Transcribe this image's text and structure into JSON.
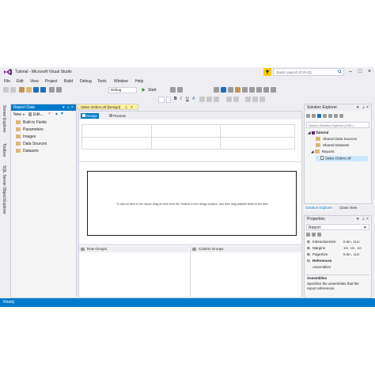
{
  "window": {
    "title": "Tutorial - Microsoft Visual Studio"
  },
  "quick_launch": {
    "placeholder": "Quick Launch (Ctrl+Q)"
  },
  "menu": [
    "File",
    "Edit",
    "View",
    "Project",
    "Build",
    "Debug",
    "Tools",
    "Window",
    "Help"
  ],
  "toolbar": {
    "config": "Debug",
    "start": "Start"
  },
  "side_tabs": [
    "Server Explorer",
    "Toolbox",
    "SQL Server Object Explorer"
  ],
  "report_data": {
    "title": "Report Data",
    "new_label": "New",
    "edit_label": "Edit...",
    "items": [
      "Built-in Fields",
      "Parameters",
      "Images",
      "Data Sources",
      "Datasets"
    ]
  },
  "document_tab": {
    "label": "Sales Orders.rdl [Design]"
  },
  "view_tabs": {
    "design": "Design",
    "preview": "Preview"
  },
  "design_surface": {
    "message": "To add an item to the report: drag an item from the Toolbox to the design surface, and then drag dataset fields to the item."
  },
  "groups": {
    "row": "Row Groups",
    "column": "Column Groups"
  },
  "solution_explorer": {
    "title": "Solution Explorer",
    "search_placeholder": "Search Solution Explorer (Ctrl+;)",
    "items": [
      {
        "label": "Tutorial"
      },
      {
        "label": "Shared Data Sources"
      },
      {
        "label": "Shared Datasets"
      },
      {
        "label": "Reports"
      },
      {
        "label": "Sales Orders.rdl"
      }
    ],
    "tabs": [
      "Solution Explorer",
      "Class View"
    ]
  },
  "properties": {
    "title": "Properties",
    "object": "Report",
    "rows": [
      {
        "name": "InteractiveSize",
        "value": "8.5in, 11in"
      },
      {
        "name": "Margins",
        "value": "1in, 1in, 1in"
      },
      {
        "name": "PageSize",
        "value": "8.5in, 11in"
      }
    ],
    "section": "References",
    "sub_item": "Assemblies",
    "help_title": "Assemblies",
    "help_text": "Specifies the assemblies that the report references."
  },
  "status": {
    "text": "Ready"
  },
  "colors": {
    "accent": "#007acc",
    "chrome": "#eeeef2",
    "tab_highlight": "#fff29d",
    "folder": "#dcb67a",
    "vs_purple": "#68217a"
  }
}
